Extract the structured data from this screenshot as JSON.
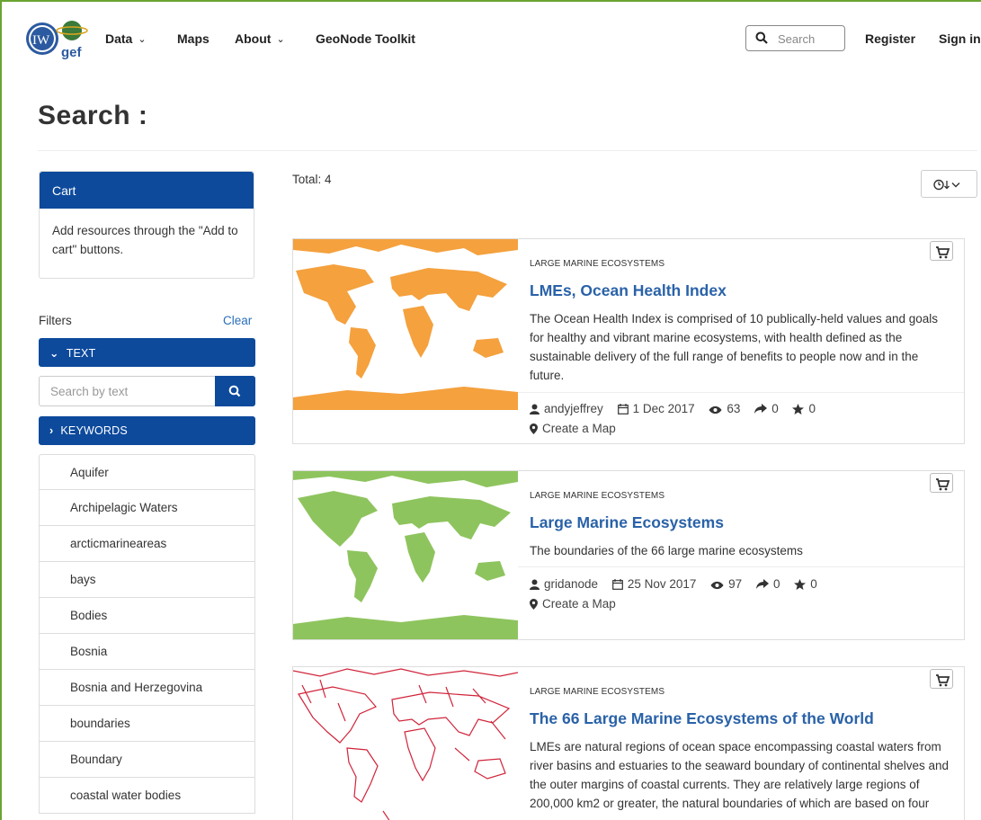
{
  "nav": {
    "items": [
      {
        "label": "Data",
        "dropdown": true
      },
      {
        "label": "Maps",
        "dropdown": false
      },
      {
        "label": "About",
        "dropdown": true
      },
      {
        "label": "GeoNode Toolkit",
        "dropdown": false
      }
    ],
    "search_placeholder": "Search",
    "register": "Register",
    "sign_in": "Sign in",
    "logo_text_main": "IW",
    "logo_text_sub": "gef"
  },
  "page": {
    "title": "Search :"
  },
  "cart": {
    "title": "Cart",
    "body": "Add resources through the \"Add to cart\" buttons."
  },
  "filters": {
    "label": "Filters",
    "clear": "Clear",
    "text_section": "TEXT",
    "text_placeholder": "Search by text",
    "keywords_section": "KEYWORDS",
    "keywords": [
      "Aquifer",
      "Archipelagic Waters",
      "arcticmarineareas",
      "bays",
      "Bodies",
      "Bosnia",
      "Bosnia and Herzegovina",
      "boundaries",
      "Boundary",
      "coastal water bodies"
    ]
  },
  "results": {
    "total": "Total: 4",
    "items": [
      {
        "category": "LARGE MARINE ECOSYSTEMS",
        "title": "LMEs, Ocean Health Index",
        "abstract": "The Ocean Health Index is comprised of 10 publically-held values and goals for healthy and vibrant marine ecosystems, with health defined as the sustainable delivery of the full range of benefits to people now and in the future.",
        "owner": "andyjeffrey",
        "date": "1 Dec 2017",
        "views": "63",
        "shares": "0",
        "rating": "0",
        "map_link": "Create a Map",
        "thumb_color": "#f4a13e"
      },
      {
        "category": "LARGE MARINE ECOSYSTEMS",
        "title": "Large Marine Ecosystems",
        "abstract": "The boundaries of the 66 large marine ecosystems",
        "owner": "gridanode",
        "date": "25 Nov 2017",
        "views": "97",
        "shares": "0",
        "rating": "0",
        "map_link": "Create a Map",
        "thumb_color": "#8ec45e"
      },
      {
        "category": "LARGE MARINE ECOSYSTEMS",
        "title": "The 66 Large Marine Ecosystems of the World",
        "abstract": "LMEs are natural regions of ocean space encompassing coastal waters from river basins and estuaries to the seaward boundary of continental shelves and the outer margins of coastal currents. They are relatively large regions of 200,000 km2 or greater, the natural boundaries of which are based on four",
        "thumb_color": "#d0243a"
      }
    ]
  },
  "colors": {
    "primary": "#0d4a9c",
    "link": "#2a62a8",
    "frame": "#6aa332"
  }
}
